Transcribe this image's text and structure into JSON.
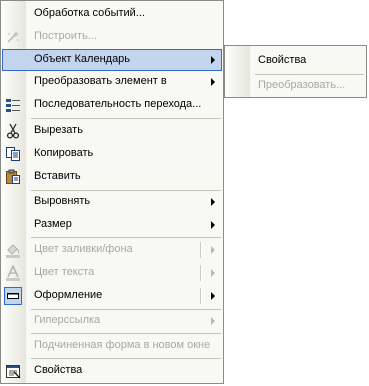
{
  "menu": {
    "items": [
      {
        "label": "Обработка событий...",
        "icon": "none",
        "enabled": true
      },
      {
        "label": "Построить...",
        "icon": "build-wand-icon",
        "enabled": false
      },
      {
        "label": "Объект Календарь",
        "icon": "none",
        "enabled": true,
        "submenu": true,
        "highlighted": true
      },
      {
        "label": "Преобразовать элемент в",
        "icon": "none",
        "enabled": true,
        "submenu": true
      },
      {
        "label": "Последовательность перехода...",
        "icon": "tab-order-icon",
        "enabled": true
      },
      {
        "label": "Вырезать",
        "icon": "scissors-icon",
        "enabled": true
      },
      {
        "label": "Копировать",
        "icon": "copy-icon",
        "enabled": true
      },
      {
        "label": "Вставить",
        "icon": "paste-icon",
        "enabled": true
      },
      {
        "label": "Выровнять",
        "icon": "none",
        "enabled": true,
        "submenu": true
      },
      {
        "label": "Размер",
        "icon": "none",
        "enabled": true,
        "submenu": true
      },
      {
        "label": "Цвет заливки/фона",
        "icon": "fill-color-icon",
        "enabled": false,
        "submenu": true
      },
      {
        "label": "Цвет текста",
        "icon": "font-color-icon",
        "enabled": false,
        "submenu": true
      },
      {
        "label": "Оформление",
        "icon": "special-effect-icon",
        "enabled": true,
        "submenu": true
      },
      {
        "label": "Гиперссылка",
        "icon": "none",
        "enabled": false,
        "submenu": true
      },
      {
        "label": "Подчиненная форма в новом окне",
        "icon": "none",
        "enabled": false
      },
      {
        "label": "Свойства",
        "icon": "properties-icon",
        "enabled": true
      }
    ]
  },
  "submenu": {
    "items": [
      {
        "label": "Свойства",
        "enabled": true
      },
      {
        "label": "Преобразовать...",
        "enabled": false
      }
    ]
  },
  "colors": {
    "highlight_fill": "#c2d4ee",
    "highlight_border": "#316ac5",
    "disabled_text": "#a8a8a8",
    "menu_background": "#f8f8f5"
  }
}
